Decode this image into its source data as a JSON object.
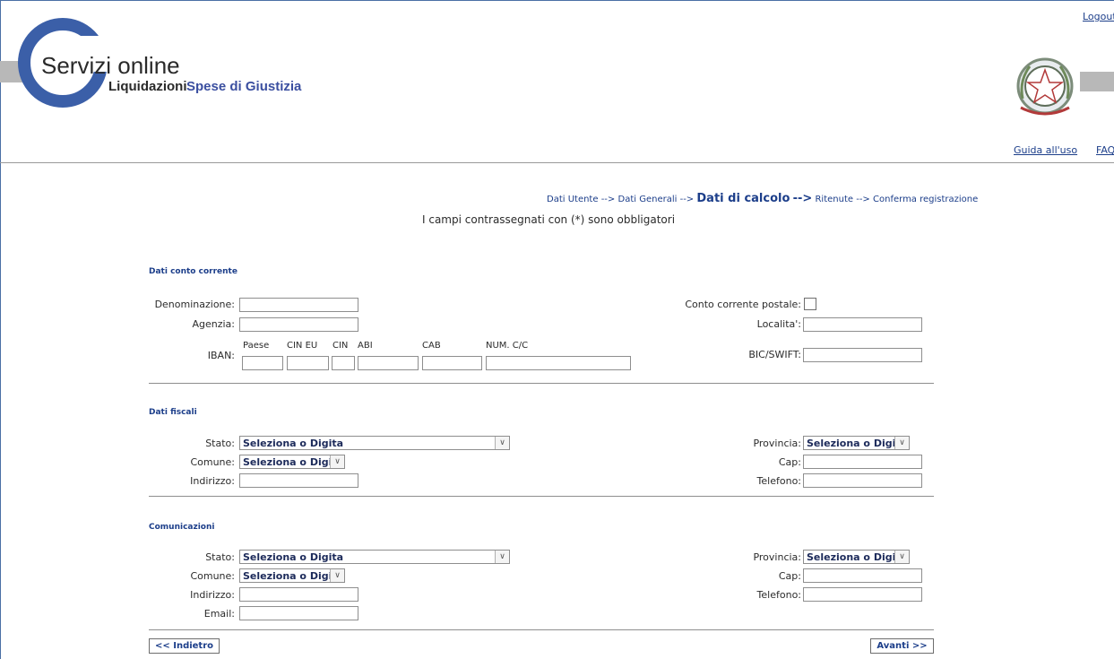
{
  "header": {
    "logout": "Logout",
    "brand_line1": "Servizi online",
    "brand_line2a": "Liquidazioni",
    "brand_line2b": "Spese di Giustizia",
    "guide": "Guida all'uso",
    "faq": "FAQ"
  },
  "breadcrumb": {
    "step1": "Dati Utente",
    "sep": "-->",
    "step2": "Dati Generali",
    "step3": "Dati di calcolo",
    "step4": "Ritenute",
    "step5": "Conferma registrazione"
  },
  "required_note": "I campi contrassegnati con (*) sono obbligatori",
  "conto": {
    "title": "Dati conto corrente",
    "denominazione": "Denominazione:",
    "agenzia": "Agenzia:",
    "iban": "IBAN:",
    "iban_parts": [
      "Paese",
      "CIN EU",
      "CIN",
      "ABI",
      "CAB",
      "NUM. C/C"
    ],
    "postale": "Conto corrente postale:",
    "localita": "Localita':",
    "bic": "BIC/SWIFT:"
  },
  "fiscali": {
    "title": "Dati fiscali",
    "stato": "Stato:",
    "comune": "Comune:",
    "indirizzo": "Indirizzo:",
    "provincia": "Provincia:",
    "cap": "Cap:",
    "telefono": "Telefono:",
    "select_placeholder": "Seleziona o Digita"
  },
  "comunicazioni": {
    "title": "Comunicazioni",
    "stato": "Stato:",
    "comune": "Comune:",
    "indirizzo": "Indirizzo:",
    "email": "Email:",
    "provincia": "Provincia:",
    "cap": "Cap:",
    "telefono": "Telefono:",
    "select_placeholder": "Seleziona o Digita"
  },
  "buttons": {
    "back": "<< Indietro",
    "next": "Avanti >>"
  }
}
